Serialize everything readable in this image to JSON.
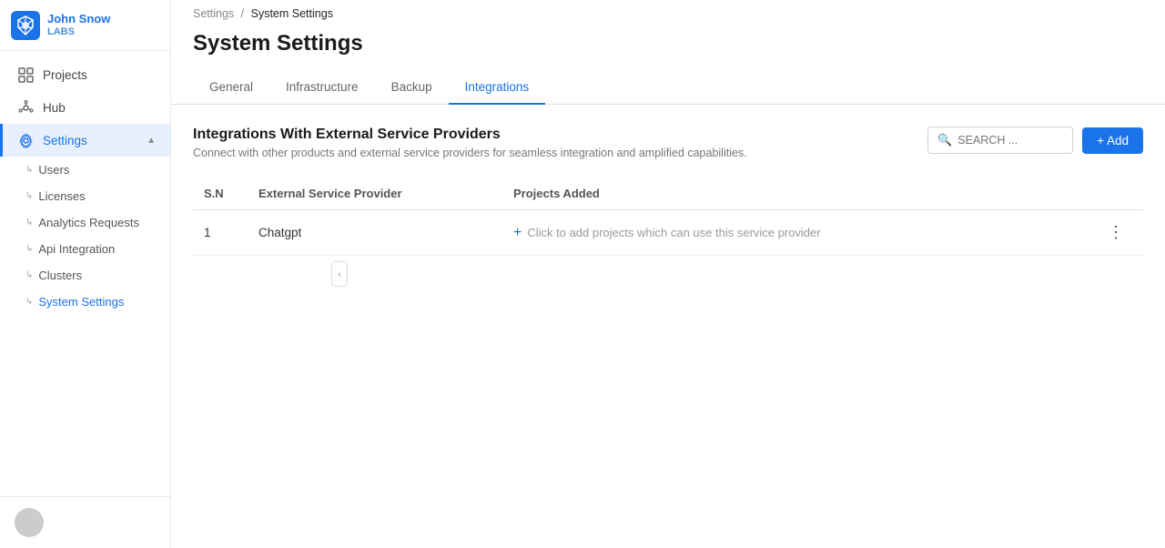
{
  "logo": {
    "line1": "John Snow",
    "line2": "LABS"
  },
  "sidebar": {
    "nav": [
      {
        "id": "projects",
        "label": "Projects",
        "icon": "grid"
      },
      {
        "id": "hub",
        "label": "Hub",
        "icon": "hub"
      },
      {
        "id": "settings",
        "label": "Settings",
        "icon": "gear",
        "active": true,
        "expanded": true
      }
    ],
    "sub_nav": [
      {
        "id": "users",
        "label": "Users"
      },
      {
        "id": "licenses",
        "label": "Licenses"
      },
      {
        "id": "analytics",
        "label": "Analytics Requests"
      },
      {
        "id": "api",
        "label": "Api Integration"
      },
      {
        "id": "clusters",
        "label": "Clusters"
      },
      {
        "id": "system-settings",
        "label": "System Settings",
        "active": true
      }
    ]
  },
  "breadcrumb": {
    "parent": "Settings",
    "separator": "/",
    "current": "System Settings"
  },
  "page": {
    "title": "System Settings"
  },
  "tabs": [
    {
      "id": "general",
      "label": "General"
    },
    {
      "id": "infrastructure",
      "label": "Infrastructure"
    },
    {
      "id": "backup",
      "label": "Backup"
    },
    {
      "id": "integrations",
      "label": "Integrations",
      "active": true
    }
  ],
  "integrations": {
    "title": "Integrations With External Service Providers",
    "subtitle": "Connect with other products and external service providers for seamless integration and amplified capabilities.",
    "search_placeholder": "SEARCH ...",
    "add_button": "+ Add",
    "table": {
      "columns": [
        "S.N",
        "External Service Provider",
        "Projects Added"
      ],
      "rows": [
        {
          "sn": "1",
          "provider": "Chatgpt",
          "projects_placeholder": "Click to add projects which can use this service provider"
        }
      ]
    }
  }
}
